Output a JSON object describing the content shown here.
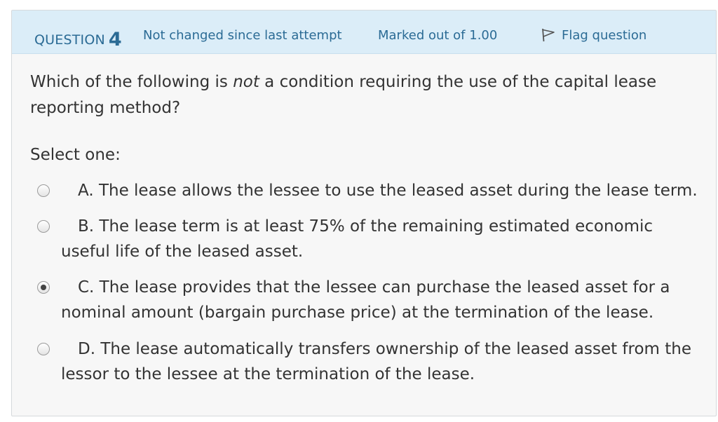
{
  "header": {
    "question_label": "QUESTION",
    "question_number": "4",
    "state": "Not changed since last attempt",
    "grade": "Marked out of 1.00",
    "flag_label": "Flag question",
    "flag_icon": "flag-outline-icon",
    "colors": {
      "header_bg": "#dbedf8",
      "header_text": "#2b6b95"
    }
  },
  "question": {
    "text_before": "Which of the following is ",
    "text_emphasis": "not",
    "text_after": " a condition requiring the use of the capital lease reporting method?"
  },
  "prompt": "Select one:",
  "options": [
    {
      "text": "A. The lease allows the lessee to use the leased asset during the lease term.",
      "selected": false
    },
    {
      "text": "B. The lease term is at least 75% of the remaining estimated economic useful life of the leased asset.",
      "selected": false
    },
    {
      "text": "C. The lease provides that the lessee can purchase the leased asset for a nominal amount (bargain purchase price) at the termination of the lease.",
      "selected": true
    },
    {
      "text": "D. The lease automatically transfers ownership of the leased asset from the lessor to the lessee at the termination of the lease.",
      "selected": false
    }
  ]
}
